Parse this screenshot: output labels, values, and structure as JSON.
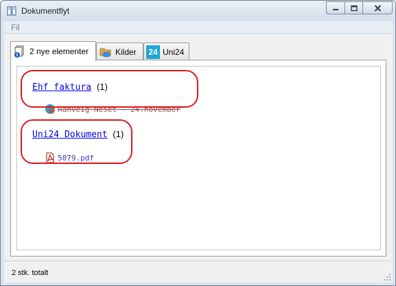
{
  "window": {
    "title": "Dokumentflyt"
  },
  "menu": {
    "file": "Fil"
  },
  "tabs": [
    {
      "label": "2 nye elementer",
      "icon": "documents-info-icon",
      "active": true
    },
    {
      "label": "Kilder",
      "icon": "cloud-folder-icon",
      "active": false
    },
    {
      "label": "Uni24",
      "icon": "uni24-logo-icon",
      "badge": "24",
      "active": false
    }
  ],
  "groups": [
    {
      "title": "Ehf faktura",
      "count": "(1)",
      "items": [
        {
          "text": "Ranveig Neset - 24.november",
          "icon": "globe-icon"
        }
      ]
    },
    {
      "title": "Uni24 Dokument",
      "count": "(1)",
      "items": [
        {
          "text": "5079.pdf",
          "icon": "pdf-icon"
        }
      ]
    }
  ],
  "status": {
    "text": "2 stk. totalt"
  },
  "colors": {
    "highlight": "#e0141e",
    "link": "#0000e8",
    "accent": "#1fa6d6"
  }
}
